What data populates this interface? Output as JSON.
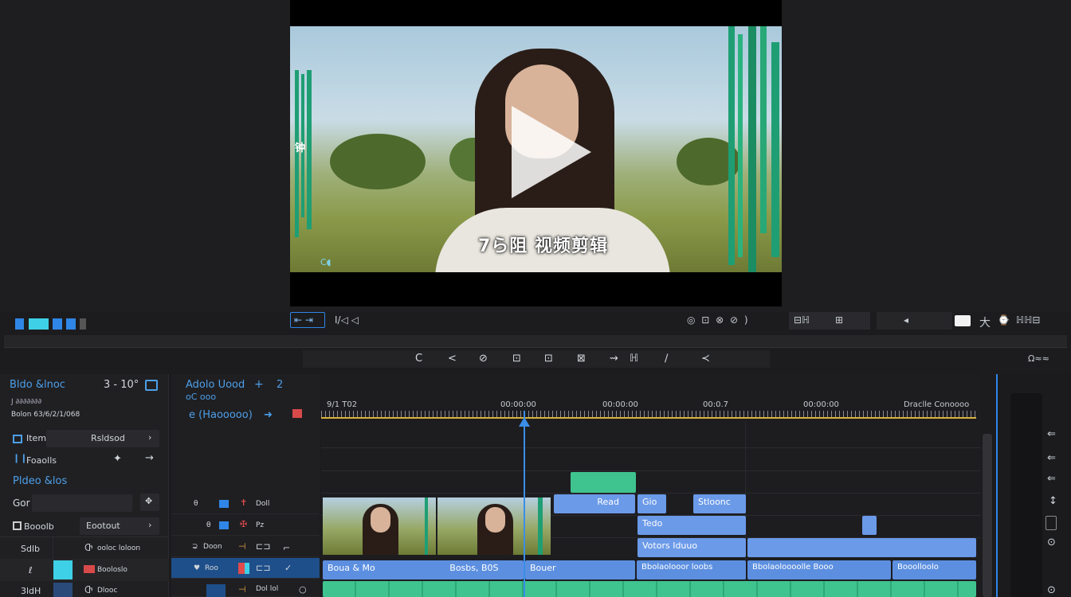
{
  "preview": {
    "subtitle": "7ら阻 视频剪辑",
    "left_overlay": "钟",
    "cc_label": "C◖"
  },
  "toolbar": {
    "left_btn_a": "⇤ ⇥",
    "left_btn_b": "I/◁ ◁",
    "right_icons": "◎  ⊡  ⊗  ⊘  )",
    "right_btn_a": "⊟ℍ",
    "right_btn_b": "⊞",
    "right_btn_c": "◂",
    "right_btn_d": "大",
    "right_btn_e": "⌚",
    "right_btn_f": "ℍℍ⊟",
    "tools_label": "Ω≈≈",
    "colors": {
      "accent": "#2f86e6",
      "clip_blue": "#6b9ae8",
      "clip_green": "#3fc48f",
      "playhead": "#3a8ee8",
      "ruler_yellow": "#d7b23a"
    }
  },
  "tools": [
    "C",
    "<",
    "⊘",
    "⊡",
    "⊡",
    "⊠",
    "⇝",
    "ℍ",
    "∕",
    "≺"
  ],
  "left_panel": {
    "title": "Bldo &lnoc",
    "title_value": "3 - 10°",
    "sub1": "J ∂∂∂∂∂∂∂",
    "sub2": "Bolon 63/6/2/1/068",
    "row1_label": "Item",
    "row1_value": "Rsldsod",
    "row2_label": "Foaolls",
    "section": "Pldeo &los",
    "field_label": "Gor",
    "row3_label": "Booolb",
    "row3_value": "Eootout",
    "row4_label": "Sdlb",
    "row4_value": "ooloc loloon",
    "row5_label": "ℓ",
    "row5_value": "Booloslo",
    "row6_label": "3ldH",
    "row6_value": "Dlooc"
  },
  "mid_panel": {
    "title": "Adolo Uood",
    "title2": "oC ooo",
    "plus": "+",
    "num": "2",
    "sub": "e (Haooooo)",
    "track1": "Doll",
    "track2": "Pz",
    "track3": "Doon",
    "track4": "Roo",
    "track5": "Dol lol"
  },
  "timeline": {
    "ticks": [
      "9/1 T02",
      "00:00:00",
      "00:00:00",
      "00:0.7",
      "00:00:00",
      "Draclle Conoooo"
    ],
    "clips": {
      "read": "Read",
      "gio": "Gio",
      "stlomo": "Stloonc",
      "tedo": "Tedo",
      "votors": "Votors Iduuo",
      "blue_row_a": "Boua & Mo",
      "blue_row_b": "Bosbs, B0S",
      "blue_row_c": "Bouer",
      "blue_row_d": "Bbolaolooor loobs",
      "blue_row_e": "Bbolaoloooolle Booo",
      "blue_row_f": "Booolloolo"
    }
  },
  "right_panel": {
    "icons": [
      "⇐",
      "⇐",
      "⇐",
      "↕",
      "⊙",
      "⊙"
    ]
  }
}
